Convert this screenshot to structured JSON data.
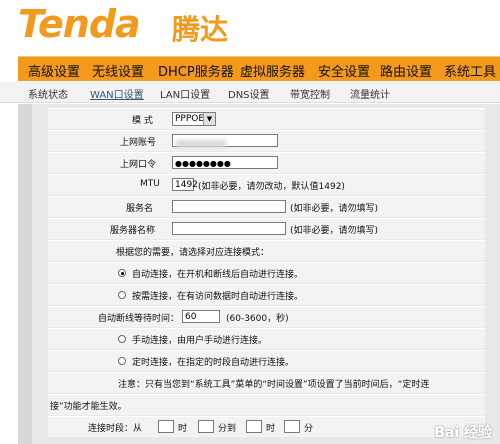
{
  "brand": {
    "logo_en": "Tenda",
    "logo_cn": "腾达"
  },
  "nav": [
    "高级设置",
    "无线设置",
    "DHCP服务器",
    "虚拟服务器",
    "安全设置",
    "路由设置",
    "系统工具"
  ],
  "subnav": [
    "系统状态",
    "WAN口设置",
    "LAN口设置",
    "DNS设置",
    "带宽控制",
    "流量统计"
  ],
  "form": {
    "mode_label": "模 式",
    "mode_value": "PPPOE",
    "account_label": "上网账号",
    "password_label": "上网口令",
    "password_value": "●●●●●●●●",
    "mtu_label": "MTU",
    "mtu_value": "1492",
    "mtu_hint": "(如非必要，请勿改动，默认值1492)",
    "service_label": "服务名",
    "service_hint": "(如非必要，请勿填写)",
    "server_label": "服务器名称",
    "server_hint": "(如非必要，请勿填写)",
    "choose_text": "根据您的需要，请选择对应连接模式：",
    "opt_auto": "自动连接，在开机和断线后自动进行连接。",
    "opt_demand": "按需连接，在有访问数据时自动进行连接。",
    "idle_label": "自动断线等待时间：",
    "idle_value": "60",
    "idle_hint": "(60-3600，秒)",
    "opt_manual": "手动连接，由用户手动进行连接。",
    "opt_timed": "定时连接，在指定的时段自动进行连接。",
    "note_line1": "注意：只有当您到“系统工具”菜单的“时间设置”项设置了当前时间后，“定时连",
    "note_line2": "接”功能才能生效。",
    "period_label": "连接时段：从",
    "period_h1": "时",
    "period_m1": "分到",
    "period_h2": "时",
    "period_m2": "分"
  },
  "watermark": "Bai 经验"
}
